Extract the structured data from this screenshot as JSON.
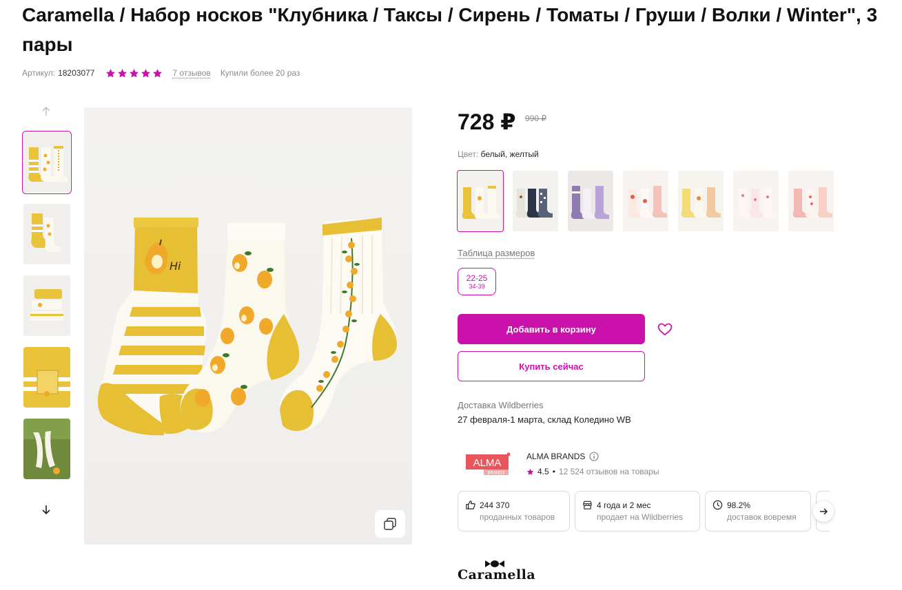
{
  "product": {
    "title": "Caramella / Набор носков \"Клубника / Таксы / Сирень / Томаты / Груши / Волки / Winter\", 3 пары",
    "article_label": "Артикул:",
    "article_value": "18203077",
    "rating": 5,
    "reviews_link": "7 отзывов",
    "bought_text": "Купили более 20 раз"
  },
  "gallery": {
    "thumbnails": [
      "pear socks set",
      "pear socks side",
      "pear socks folded",
      "pear socks close-up",
      "pear socks worn"
    ],
    "active_index": 0
  },
  "pricing": {
    "price": "728 ₽",
    "old_price": "990 ₽"
  },
  "color": {
    "label": "Цвет:",
    "value": "белый, желтый",
    "swatches": [
      "pear",
      "dachshund",
      "lilac",
      "tomato",
      "yellow",
      "strawberry",
      "pink"
    ],
    "active_index": 0
  },
  "sizes": {
    "table_link": "Таблица размеров",
    "options": [
      {
        "size": "22-25",
        "ru": "34-39"
      }
    ]
  },
  "actions": {
    "add_to_cart": "Добавить в корзину",
    "buy_now": "Купить сейчас"
  },
  "delivery": {
    "label": "Доставка Wildberries",
    "date": "27 февраля-1 марта, склад Коледино WB"
  },
  "seller": {
    "logo_text": "ALMA",
    "logo_sub": "BRANDS",
    "name": "ALMA BRANDS",
    "rating": "4.5",
    "reviews": "12 524 отзывов на товары",
    "stats": [
      {
        "icon": "thumbs-up-icon",
        "value": "244 370",
        "caption": "проданных товаров"
      },
      {
        "icon": "shop-icon",
        "value": "4 года и 2 мес",
        "caption": "продает на Wildberries"
      },
      {
        "icon": "clock-icon",
        "value": "98.2%",
        "caption": "доставок вовремя"
      }
    ]
  },
  "brand": {
    "name": "Caramella"
  },
  "colors": {
    "accent": "#cb11ab",
    "sock_yellow": "#e9c33a",
    "pear": "#f0a92a"
  }
}
